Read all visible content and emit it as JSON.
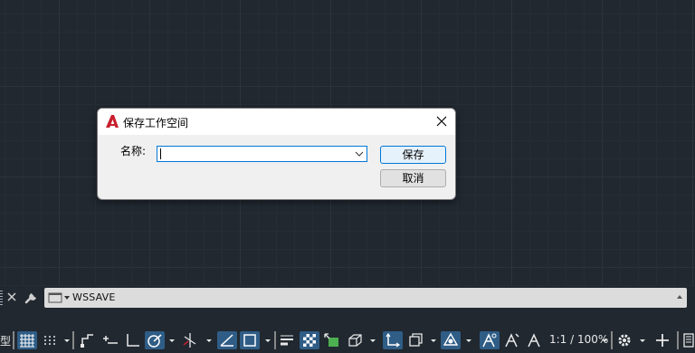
{
  "dialog": {
    "title": "保存工作空间",
    "name_label": "名称:",
    "name_value": "",
    "save_label": "保存",
    "cancel_label": "取消"
  },
  "command_line": {
    "text": "WSSAVE"
  },
  "status_bar": {
    "model_label_partial": "型",
    "scale_label": "1:1 / 100%"
  },
  "colors": {
    "canvas_bg": "#212830",
    "accent": "#0078d7",
    "toggle_on": "#2f5d86",
    "logo_red": "#c8202e"
  }
}
